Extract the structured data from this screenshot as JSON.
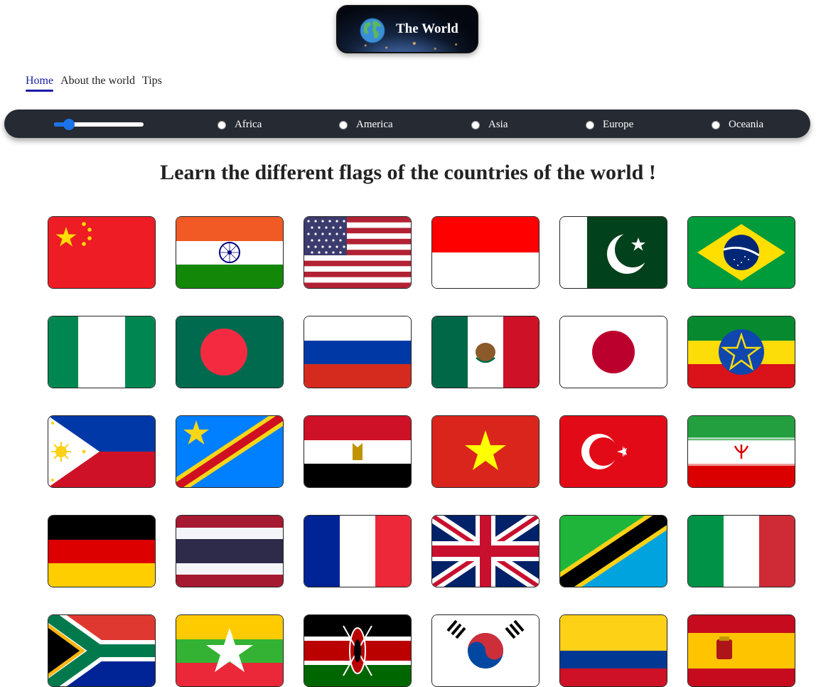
{
  "logo": {
    "text": "The World",
    "icon": "globe-icon"
  },
  "nav": {
    "items": [
      {
        "label": "Home",
        "active": true
      },
      {
        "label": "About the world"
      },
      {
        "label": "Tips"
      }
    ]
  },
  "filter": {
    "slider_value": 0.1,
    "regions": [
      "Africa",
      "America",
      "Asia",
      "Europe",
      "Oceania"
    ]
  },
  "heading": "Learn the different flags of the countries of the world !",
  "flags": [
    "china-flag",
    "india-flag",
    "usa-flag",
    "indonesia-flag",
    "pakistan-flag",
    "brazil-flag",
    "nigeria-flag",
    "bangladesh-flag",
    "russia-flag",
    "mexico-flag",
    "japan-flag",
    "ethiopia-flag",
    "philippines-flag",
    "dr-congo-flag",
    "egypt-flag",
    "vietnam-flag",
    "turkey-flag",
    "iran-flag",
    "germany-flag",
    "thailand-flag",
    "france-flag",
    "uk-flag",
    "tanzania-flag",
    "italy-flag",
    "south-africa-flag",
    "myanmar-flag",
    "kenya-flag",
    "south-korea-flag",
    "colombia-flag",
    "spain-flag"
  ]
}
